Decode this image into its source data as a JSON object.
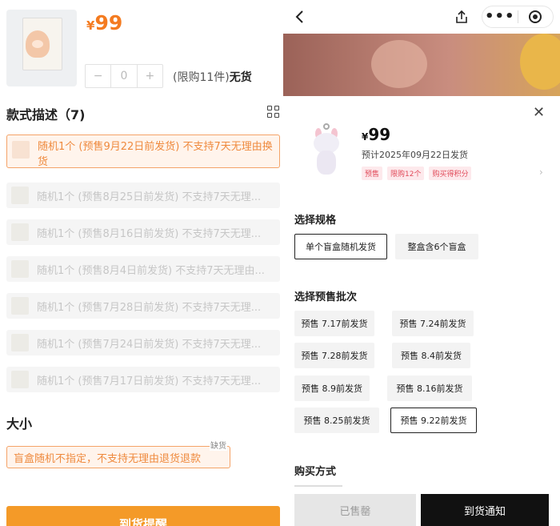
{
  "left": {
    "price": {
      "currency": "¥",
      "value": "99"
    },
    "stepper": {
      "minus": "−",
      "qty": "0",
      "plus": "+"
    },
    "limit": {
      "text": "(限购11件)",
      "status": "无货"
    },
    "style_section": {
      "title": "款式描述（7)"
    },
    "options": [
      {
        "label": "随机1个 (预售9月22日前发货) 不支持7天无理由换货",
        "selected": true
      },
      {
        "label": "随机1个 (预售8月25日前发货) 不支持7天无理...",
        "selected": false
      },
      {
        "label": "随机1个 (预售8月16日前发货) 不支持7天无理...",
        "selected": false
      },
      {
        "label": "随机1个 (预售8月4日前发货) 不支持7天无理由...",
        "selected": false
      },
      {
        "label": "随机1个 (预售7月28日前发货) 不支持7天无理...",
        "selected": false
      },
      {
        "label": "随机1个 (预售7月24日前发货) 不支持7天无理...",
        "selected": false
      },
      {
        "label": "随机1个 (预售7月17日前发货) 不支持7天无理...",
        "selected": false
      }
    ],
    "size_section": {
      "title": "大小"
    },
    "size_option": {
      "label": "盲盒随机不指定，不支持无理由退货退款",
      "tag": "缺货"
    },
    "bottom_button": "到货提醒"
  },
  "right": {
    "product": {
      "currency": "¥",
      "price": "99",
      "ship": "预计2025年09月22日发货",
      "tags": [
        "预售",
        "限购12个",
        "购买得积分"
      ]
    },
    "spec_section": {
      "title": "选择规格",
      "options": [
        "单个盲盒随机发货",
        "整盒含6个盲盒"
      ]
    },
    "batch_section": {
      "title": "选择预售批次",
      "options": [
        "预售 7.17前发货",
        "预售 7.24前发货",
        "预售 7.28前发货",
        "预售 8.4前发货",
        "预售 8.9前发货",
        "预售 8.16前发货",
        "预售 8.25前发货",
        "预售 9.22前发货"
      ]
    },
    "buy_section": {
      "title": "购买方式"
    },
    "actions": {
      "sold_out": "已售罄",
      "notify": "到货通知"
    }
  },
  "icons": [
    "back-icon",
    "share-icon",
    "more-icon",
    "record-icon",
    "close-icon",
    "grid-icon",
    "chevron-right-icon"
  ]
}
